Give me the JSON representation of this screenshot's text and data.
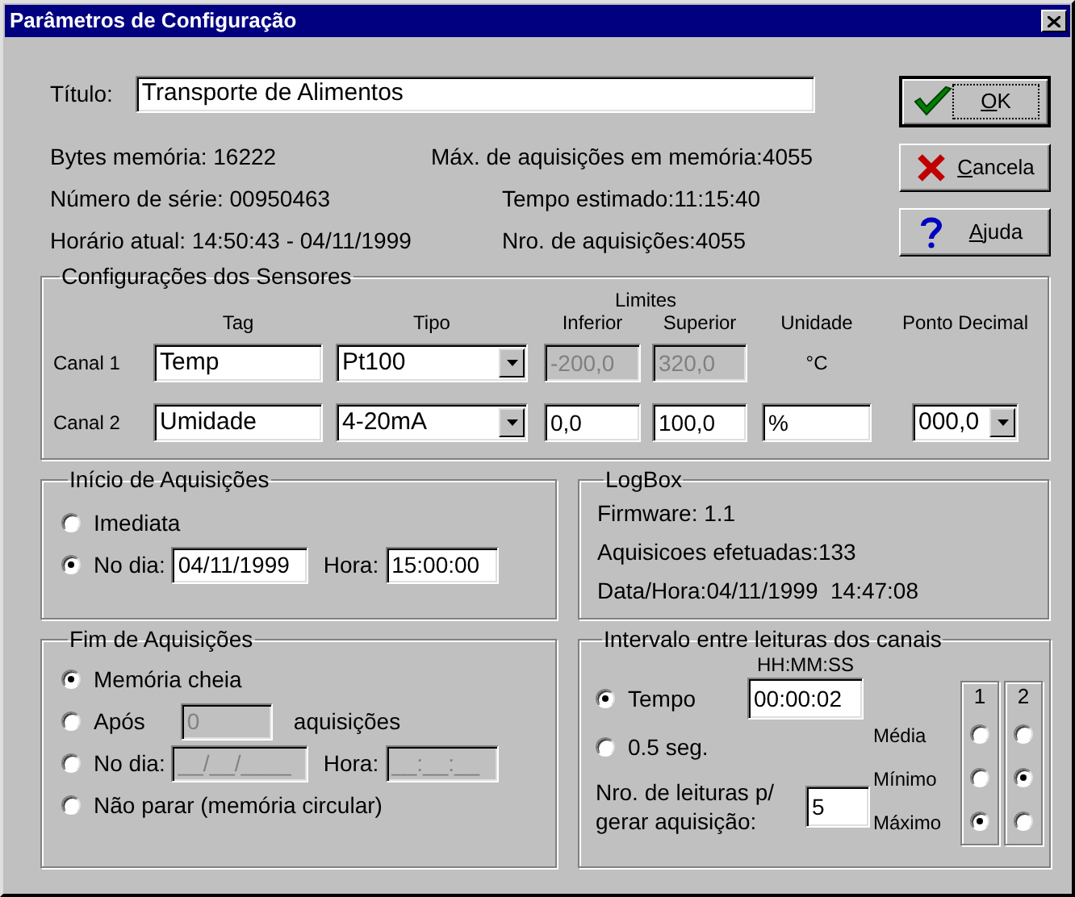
{
  "window": {
    "title": "Parâmetros de Configuração"
  },
  "title_field": {
    "label": "Título:",
    "value": "Transporte de Alimentos"
  },
  "info_left": [
    "Bytes memória: 16222",
    "Número de série: 00950463",
    "Horário atual: 14:50:43 - 04/11/1999"
  ],
  "info_right": [
    "Máx. de aquisições em memória:4055",
    "Tempo estimado:11:15:40",
    "Nro. de aquisições:4055"
  ],
  "buttons": [
    {
      "label": "OK",
      "kind": "ok",
      "default": true
    },
    {
      "label": "Cancela",
      "kind": "cancel",
      "default": false
    },
    {
      "label": "Ajuda",
      "kind": "help",
      "default": false
    }
  ],
  "sensors": {
    "title": "Configurações dos Sensores",
    "limits_header": "Limites",
    "headers": [
      "Tag",
      "Tipo",
      "Inferior",
      "Superior",
      "Unidade",
      "Ponto Decimal"
    ],
    "channels": [
      {
        "label": "Canal 1",
        "tag": "Temp",
        "type": "Pt100",
        "lower": "-200,0",
        "upper": "320,0",
        "limits_disabled": true,
        "unit": "°C",
        "kind": "text"
      },
      {
        "label": "Canal 2",
        "tag": "Umidade",
        "type": "4-20mA",
        "lower": "0,0",
        "upper": "100,0",
        "limits_disabled": false,
        "unit": "%",
        "kind": "field",
        "decimal": "000,0"
      }
    ]
  },
  "start": {
    "title": "Início de Aquisições",
    "options": [
      {
        "label": "Imediata",
        "selected": false,
        "kind": "plain"
      },
      {
        "label": "No dia:",
        "selected": true,
        "kind": "datetime",
        "date": "04/11/1999",
        "time_label": "Hora:",
        "time": "15:00:00",
        "disabled": false
      }
    ]
  },
  "end": {
    "title": "Fim de Aquisições",
    "options": [
      {
        "label": "Memória cheia",
        "selected": true,
        "kind": "plain"
      },
      {
        "label": "Após",
        "selected": false,
        "kind": "count",
        "value": "0",
        "suffix": "aquisições",
        "disabled": true
      },
      {
        "label": "No dia:",
        "selected": false,
        "kind": "datetime",
        "date": "__/__/____",
        "time_label": "Hora:",
        "time": "__:__:__",
        "disabled": true
      },
      {
        "label": "Não parar (memória circular)",
        "selected": false,
        "kind": "plain"
      }
    ]
  },
  "logbox": {
    "title": "LogBox",
    "lines": [
      "Firmware: 1.1",
      "Aquisicoes efetuadas:133",
      "Data/Hora:04/11/1999  14:47:08"
    ]
  },
  "interval": {
    "title": "Intervalo entre leituras dos canais",
    "time_header": "HH:MM:SS",
    "options": [
      {
        "label": "Tempo",
        "selected": true,
        "value": "00:00:02"
      },
      {
        "label": "0.5 seg.",
        "selected": false
      }
    ],
    "readings_label": "Nro. de leituras p/ gerar aquisição:",
    "readings_value": "5",
    "statistics": {
      "rows": [
        "Média",
        "Mínimo",
        "Máximo"
      ],
      "columns": [
        {
          "label": "1",
          "options": [
            {
              "selected": false
            },
            {
              "selected": false
            },
            {
              "selected": true
            }
          ]
        },
        {
          "label": "2",
          "options": [
            {
              "selected": false
            },
            {
              "selected": true
            },
            {
              "selected": false
            }
          ]
        }
      ]
    }
  }
}
